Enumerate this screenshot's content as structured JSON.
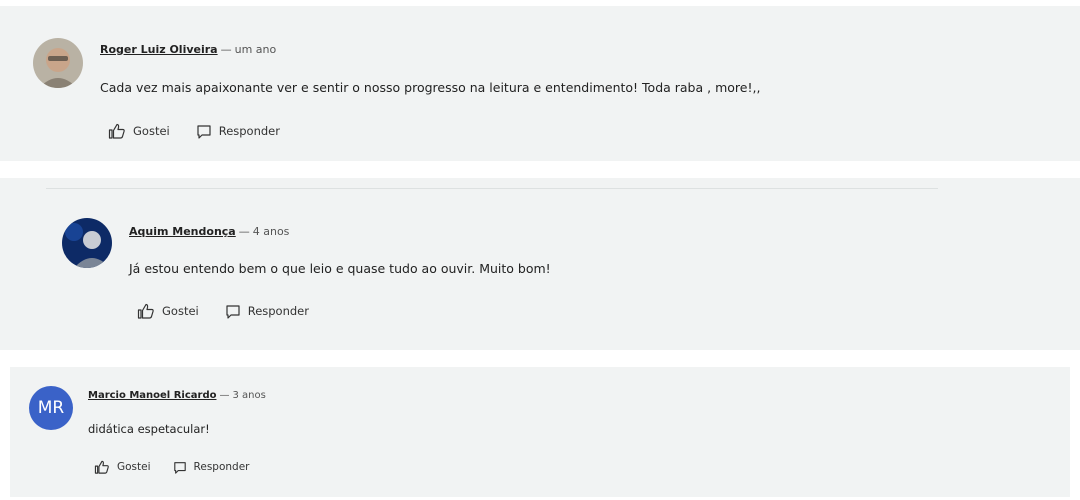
{
  "colors": {
    "card_bg": "#f1f3f3",
    "initials_avatar_bg": "#3a62c8"
  },
  "comments": [
    {
      "author": "Roger Luiz Oliveira",
      "separator": "—",
      "time": "um ano",
      "text": "Cada vez mais apaixonante ver e sentir o nosso progresso na leitura e entendimento! Toda raba , more!,,",
      "like_label": "Gostei",
      "reply_label": "Responder",
      "avatar_icon": "user-photo"
    },
    {
      "author": "Aquim Mendonça",
      "separator": "—",
      "time": "4 anos",
      "text": "Já estou entendo bem o que leio e quase tudo ao ouvir. Muito bom!",
      "like_label": "Gostei",
      "reply_label": "Responder",
      "avatar_icon": "user-photo"
    },
    {
      "author": "Marcio Manoel Ricardo",
      "separator": "—",
      "time": "3 anos",
      "text": "didática espetacular!",
      "like_label": "Gostei",
      "reply_label": "Responder",
      "avatar_initials": "MR"
    }
  ]
}
